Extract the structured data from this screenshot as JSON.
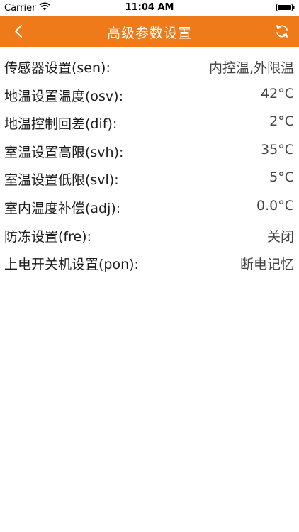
{
  "status_bar": {
    "carrier": "Carrier",
    "time": "11:04 AM"
  },
  "nav": {
    "title": "高级参数设置",
    "back_icon": "chevron-left-icon",
    "refresh_icon": "refresh-icon",
    "background_color": "#ef7a1a"
  },
  "settings": [
    {
      "label": "传感器设置(sen):",
      "value": "内控温,外限温"
    },
    {
      "label": "地温设置温度(osv):",
      "value": "42°C"
    },
    {
      "label": "地温控制回差(dif):",
      "value": "2°C"
    },
    {
      "label": "室温设置高限(svh):",
      "value": "35°C"
    },
    {
      "label": "室温设置低限(svl):",
      "value": "5°C"
    },
    {
      "label": "室内温度补偿(adj):",
      "value": "0.0°C"
    },
    {
      "label": "防冻设置(fre):",
      "value": "关闭"
    },
    {
      "label": "上电开关机设置(pon):",
      "value": "断电记忆"
    }
  ]
}
